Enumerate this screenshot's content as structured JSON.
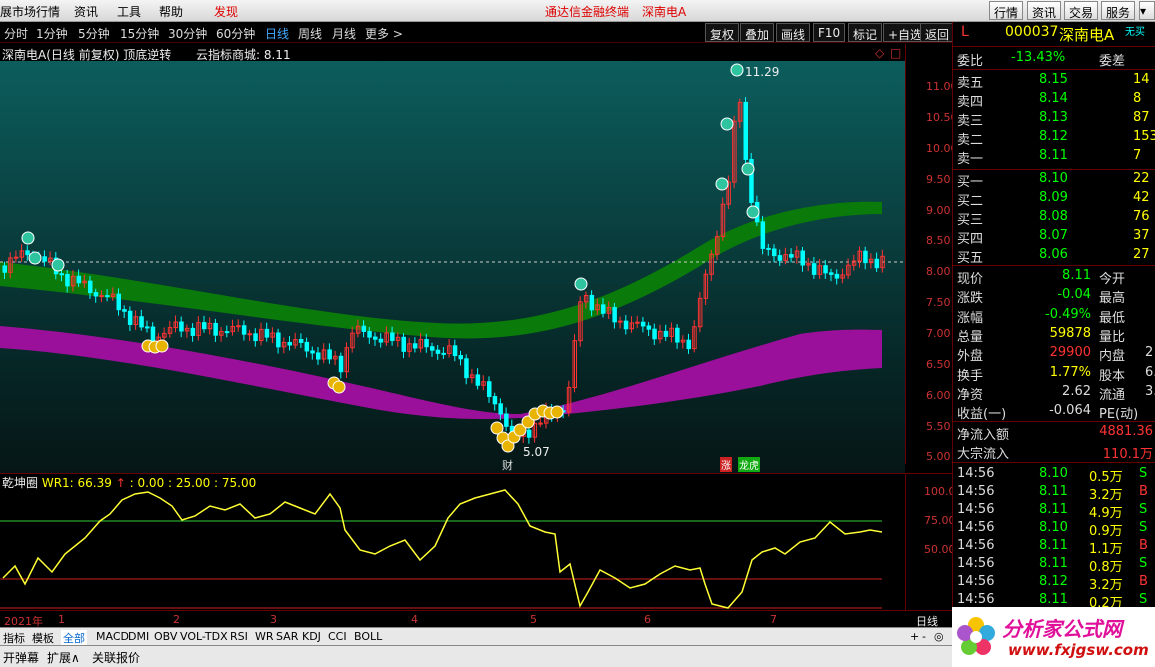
{
  "menu": {
    "items": [
      "展市场行情",
      "资讯",
      "工具",
      "帮助",
      "发现"
    ],
    "center_title": "通达信金融终端",
    "stock": "深南电A",
    "right_buttons": [
      "行情",
      "资讯",
      "交易",
      "服务"
    ]
  },
  "toolbar": {
    "periods": [
      "分时",
      "1分钟",
      "5分钟",
      "15分钟",
      "30分钟",
      "60分钟",
      "日线",
      "周线",
      "月线",
      "更多 >"
    ],
    "active": "日线",
    "buttons": [
      "复权",
      "叠加",
      "画线",
      "F10",
      "标记",
      "+自选",
      "返回"
    ]
  },
  "chart_header": {
    "title": "深南电A(日线 前复权) 顶底逆转",
    "indicator": "云指标商城: 8.11"
  },
  "price_axis": [
    "11.00",
    "10.50",
    "10.00",
    "9.50",
    "9.00",
    "8.50",
    "8.00",
    "7.50",
    "7.00",
    "6.50",
    "6.00",
    "5.50",
    "5.00"
  ],
  "annotations": {
    "high": "11.29",
    "low": "5.07",
    "mark_cai": "财",
    "mark_zhang": "涨",
    "mark_lhb": "龙虎"
  },
  "indicator_header": {
    "name": "乾坤圈",
    "series": "WR1: 66.39",
    "arrow": "↑",
    "levels": ": 0.00 : 25.00 : 75.00"
  },
  "ind_axis": [
    "100.0",
    "75.00",
    "50.00"
  ],
  "dates": [
    "2021年",
    "1",
    "2",
    "3",
    "4",
    "5",
    "6",
    "7"
  ],
  "period_label": "日线",
  "tabs": [
    "指标",
    "模板",
    "全部",
    "MACD",
    "DMI",
    "OBV",
    "VOL-TDX",
    "RSI",
    "WR",
    "SAR",
    "KDJ",
    "CCI",
    "BOLL"
  ],
  "bottom": [
    "开弹幕",
    "扩展∧",
    "关联报价"
  ],
  "quote": {
    "flag": "L",
    "code": "000037",
    "name": "深南电A",
    "tag": "无买",
    "weibi_label": "委比",
    "weibi": "-13.43%",
    "weicha_label": "委差",
    "asks": [
      {
        "l": "卖五",
        "p": "8.15",
        "v": "14"
      },
      {
        "l": "卖四",
        "p": "8.14",
        "v": "8"
      },
      {
        "l": "卖三",
        "p": "8.13",
        "v": "87"
      },
      {
        "l": "卖二",
        "p": "8.12",
        "v": "153"
      },
      {
        "l": "卖一",
        "p": "8.11",
        "v": "7"
      }
    ],
    "bids": [
      {
        "l": "买一",
        "p": "8.10",
        "v": "22"
      },
      {
        "l": "买二",
        "p": "8.09",
        "v": "42"
      },
      {
        "l": "买三",
        "p": "8.08",
        "v": "76"
      },
      {
        "l": "买四",
        "p": "8.07",
        "v": "37"
      },
      {
        "l": "买五",
        "p": "8.06",
        "v": "27"
      }
    ],
    "stats": [
      {
        "a": "现价",
        "av": "8.11",
        "ac": "grn",
        "b": "今开",
        "bv": ""
      },
      {
        "a": "涨跌",
        "av": "-0.04",
        "ac": "grn",
        "b": "最高",
        "bv": ""
      },
      {
        "a": "涨幅",
        "av": "-0.49%",
        "ac": "grn",
        "b": "最低",
        "bv": ""
      },
      {
        "a": "总量",
        "av": "59878",
        "ac": "yel",
        "b": "量比",
        "bv": ""
      },
      {
        "a": "外盘",
        "av": "29900",
        "ac": "red",
        "b": "内盘",
        "bv": "2"
      },
      {
        "a": "换手",
        "av": "1.77%",
        "ac": "yel",
        "b": "股本",
        "bv": "6."
      },
      {
        "a": "净资",
        "av": "2.62",
        "ac": "wht",
        "b": "流通",
        "bv": "3."
      },
      {
        "a": "收益(一)",
        "av": "-0.064",
        "ac": "wht",
        "b": "PE(动)",
        "bv": ""
      }
    ],
    "flows": [
      {
        "l": "净流入额",
        "v": "4881.36"
      },
      {
        "l": "大宗流入",
        "v": "110.1万"
      }
    ],
    "ticks": [
      {
        "t": "14:56",
        "p": "8.10",
        "v": "0.5万",
        "s": "S"
      },
      {
        "t": "14:56",
        "p": "8.11",
        "v": "3.2万",
        "s": "B"
      },
      {
        "t": "14:56",
        "p": "8.11",
        "v": "4.9万",
        "s": "S"
      },
      {
        "t": "14:56",
        "p": "8.10",
        "v": "0.9万",
        "s": "S"
      },
      {
        "t": "14:56",
        "p": "8.11",
        "v": "1.1万",
        "s": "B"
      },
      {
        "t": "14:56",
        "p": "8.11",
        "v": "0.8万",
        "s": "S"
      },
      {
        "t": "14:56",
        "p": "8.12",
        "v": "3.2万",
        "s": "B"
      },
      {
        "t": "14:56",
        "p": "8.11",
        "v": "0.2万",
        "s": "S"
      }
    ]
  },
  "watermark": {
    "text": "分析家公式网",
    "url": "www.fxjgsw.com"
  },
  "colors": {
    "up": "#ff3333",
    "down": "#00ffff",
    "ma_band_upper": "#0a7a0a",
    "ma_band_lower": "#a010a0",
    "wr_line": "#ffff33",
    "level_green": "#33cc33",
    "level_red": "#cc2222"
  }
}
